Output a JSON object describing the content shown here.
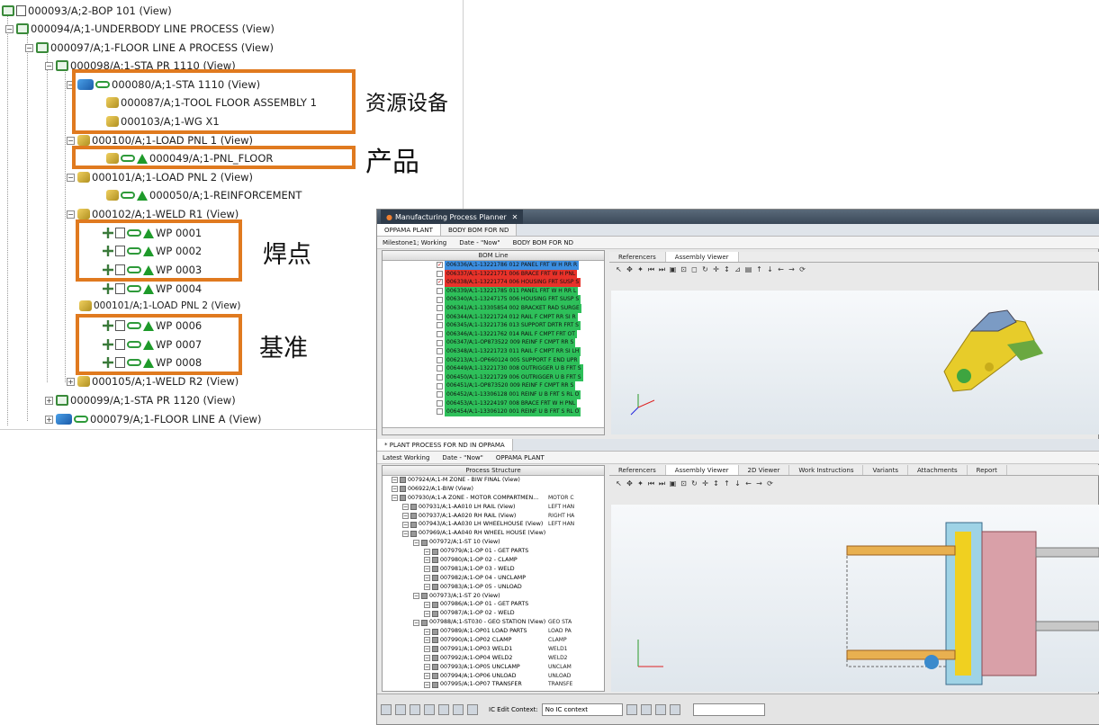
{
  "left_tree": {
    "nodes": [
      {
        "label": "000093/A;2-BOP 101 (View)"
      },
      {
        "label": "000094/A;1-UNDERBODY LINE PROCESS (View)"
      },
      {
        "label": "000097/A;1-FLOOR LINE A PROCESS (View)"
      },
      {
        "label": "000098/A;1-STA PR 1110 (View)"
      },
      {
        "label": "000080/A;1-STA 1110 (View)"
      },
      {
        "label": "000087/A;1-TOOL FLOOR ASSEMBLY 1"
      },
      {
        "label": "000103/A;1-WG X1"
      },
      {
        "label": "000100/A;1-LOAD PNL 1 (View)"
      },
      {
        "label": "000049/A;1-PNL_FLOOR"
      },
      {
        "label": "000101/A;1-LOAD PNL 2 (View)"
      },
      {
        "label": "000050/A;1-REINFORCEMENT"
      },
      {
        "label": "000102/A;1-WELD R1 (View)"
      },
      {
        "label": "WP 0001"
      },
      {
        "label": "WP 0002"
      },
      {
        "label": "WP 0003"
      },
      {
        "label": "WP 0004"
      },
      {
        "label": "000101/A;1-LOAD PNL 2 (View)"
      },
      {
        "label": "WP 0006"
      },
      {
        "label": "WP 0007"
      },
      {
        "label": "WP 0008"
      },
      {
        "label": "000105/A;1-WELD R2 (View)"
      },
      {
        "label": "000099/A;1-STA PR 1120 (View)"
      },
      {
        "label": "000079/A;1-FLOOR LINE A (View)"
      }
    ]
  },
  "callouts": {
    "resource": "资源设备",
    "product": "产品",
    "weld": "焊点",
    "datum": "基准"
  },
  "colors": {
    "callout_border": "#e07a1f"
  },
  "app": {
    "window_tab": "Manufacturing Process Planner",
    "top_tabs": [
      "OPPAMA PLANT",
      "BODY BOM FOR ND"
    ],
    "top_crumbs": [
      "Milestone1; Working",
      "Date - \"Now\"",
      "BODY BOM FOR ND"
    ],
    "bom_header": "BOM Line",
    "bom_rows": [
      {
        "text": "006336/A;1-13221786 012 PANEL FRT W H RR R",
        "bg": "#3b8ee0",
        "checked": true
      },
      {
        "text": "006337/A;1-13221771 006 BRACE FRT W H PNL",
        "bg": "#e8322a",
        "checked": false
      },
      {
        "text": "006338/A;1-13221774 006 HOUSING FRT SUSP S",
        "bg": "#e8322a",
        "checked": true
      },
      {
        "text": "006339/A;1-13221785 011 PANEL FRT W H RR L",
        "bg": "#2ec05a",
        "checked": false
      },
      {
        "text": "006340/A;1-13247175 006 HOUSING FRT SUSP S",
        "bg": "#2ec05a",
        "checked": false
      },
      {
        "text": "006341/A;1-13305854 002 BRACKET RAD SURGE",
        "bg": "#2ec05a",
        "checked": false
      },
      {
        "text": "006344/A;1-13221724 012 RAIL F CMPT RR SI R",
        "bg": "#2ec05a",
        "checked": false
      },
      {
        "text": "006345/A;1-13221736 013 SUPPORT DRTR FRT S",
        "bg": "#2ec05a",
        "checked": false
      },
      {
        "text": "006346/A;1-13221762 014 RAIL F CMPT FRT OT",
        "bg": "#2ec05a",
        "checked": false
      },
      {
        "text": "006347/A;1-OP873522 009 REINF F CMPT RR S",
        "bg": "#2ec05a",
        "checked": false
      },
      {
        "text": "006348/A;1-13221723 011 RAIL F CMPT RR SI LH",
        "bg": "#2ec05a",
        "checked": false
      },
      {
        "text": "006213/A;1-OP660124 005 SUPPORT F END UPR",
        "bg": "#2ec05a",
        "checked": false
      },
      {
        "text": "006449/A;1-13221730 008 OUTRIGGER U B FRT S",
        "bg": "#2ec05a",
        "checked": false
      },
      {
        "text": "006450/A;1-13221729 006 OUTRIGGER U B FRT S",
        "bg": "#2ec05a",
        "checked": false
      },
      {
        "text": "006451/A;1-OP873520 009 REINF F CMPT RR S",
        "bg": "#2ec05a",
        "checked": false
      },
      {
        "text": "006452/A;1-13306128 001 REINF U B FRT S RL O",
        "bg": "#2ec05a",
        "checked": false
      },
      {
        "text": "006453/A;1-13224197 008 BRACE FRT W H PNL",
        "bg": "#2ec05a",
        "checked": false
      },
      {
        "text": "006454/A;1-13306120 001 REINF U B FRT S RL O",
        "bg": "#2ec05a",
        "checked": false
      }
    ],
    "top_viewer_tabs": [
      "Referencers",
      "Assembly Viewer"
    ],
    "bottom_tab": "* PLANT PROCESS FOR ND IN OPPAMA",
    "bottom_crumbs": [
      "Latest Working",
      "Date - \"Now\"",
      "OPPAMA PLANT"
    ],
    "ps_header": "Process Structure",
    "ps_rows": [
      {
        "text": "007924/A;1-M ZONE - BIW FINAL (View)",
        "c2": "",
        "indent": 10
      },
      {
        "text": "006922/A;1-BIW (View)",
        "c2": "",
        "indent": 10
      },
      {
        "text": "007930/A;1-A ZONE - MOTOR COMPARTMEN...",
        "c2": "MOTOR C",
        "indent": 10
      },
      {
        "text": "007931/A;1-AA010 LH RAIL (View)",
        "c2": "LEFT HAN",
        "indent": 22
      },
      {
        "text": "007937/A;1-AA020 RH RAIL (View)",
        "c2": "RIGHT HA",
        "indent": 22
      },
      {
        "text": "007943/A;1-AA030 LH WHEELHOUSE (View)",
        "c2": "LEFT HAN",
        "indent": 22
      },
      {
        "text": "007969/A;1-AA040 RH WHEEL HOUSE (View)",
        "c2": "",
        "indent": 22
      },
      {
        "text": "007972/A;1-ST 10 (View)",
        "c2": "",
        "indent": 34
      },
      {
        "text": "007979/A;1-OP 01 - GET PARTS",
        "c2": "",
        "indent": 46
      },
      {
        "text": "007980/A;1-OP 02 - CLAMP",
        "c2": "",
        "indent": 46
      },
      {
        "text": "007981/A;1-OP 03 - WELD",
        "c2": "",
        "indent": 46
      },
      {
        "text": "007982/A;1-OP 04 - UNCLAMP",
        "c2": "",
        "indent": 46
      },
      {
        "text": "007983/A;1-OP 05 - UNLOAD",
        "c2": "",
        "indent": 46
      },
      {
        "text": "007973/A;1-ST 20 (View)",
        "c2": "",
        "indent": 34
      },
      {
        "text": "007986/A;1-OP 01 - GET PARTS",
        "c2": "",
        "indent": 46
      },
      {
        "text": "007987/A;1-OP 02 - WELD",
        "c2": "",
        "indent": 46
      },
      {
        "text": "007988/A;1-ST030 - GEO STATION (View)",
        "c2": "GEO STA",
        "indent": 34
      },
      {
        "text": "007989/A;1-OP01 LOAD PARTS",
        "c2": "LOAD PA",
        "indent": 46
      },
      {
        "text": "007990/A;1-OP02 CLAMP",
        "c2": "CLAMP",
        "indent": 46
      },
      {
        "text": "007991/A;1-OP03 WELD1",
        "c2": "WELD1",
        "indent": 46
      },
      {
        "text": "007992/A;1-OP04 WELD2",
        "c2": "WELD2",
        "indent": 46
      },
      {
        "text": "007993/A;1-OP05 UNCLAMP",
        "c2": "UNCLAM",
        "indent": 46
      },
      {
        "text": "007994/A;1-OP06 UNLOAD",
        "c2": "UNLOAD",
        "indent": 46
      },
      {
        "text": "007995/A;1-OP07 TRANSFER",
        "c2": "TRANSFE",
        "indent": 46
      }
    ],
    "bottom_viewer_tabs": [
      "Referencers",
      "Assembly Viewer",
      "2D Viewer",
      "Work Instructions",
      "Variants",
      "Attachments",
      "Report"
    ],
    "status": {
      "ic_label": "IC Edit Context:",
      "ic_value": "No IC context"
    }
  }
}
